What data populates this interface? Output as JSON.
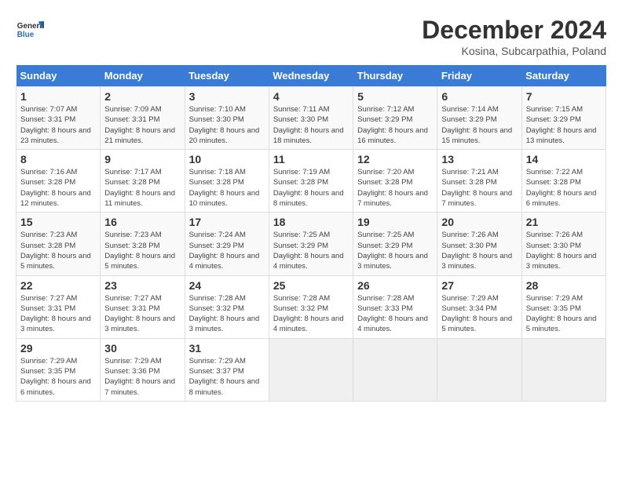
{
  "header": {
    "logo": {
      "general": "General",
      "blue": "Blue"
    },
    "title": "December 2024",
    "location": "Kosina, Subcarpathia, Poland"
  },
  "days_of_week": [
    "Sunday",
    "Monday",
    "Tuesday",
    "Wednesday",
    "Thursday",
    "Friday",
    "Saturday"
  ],
  "weeks": [
    [
      {
        "day": "1",
        "sunrise": "Sunrise: 7:07 AM",
        "sunset": "Sunset: 3:31 PM",
        "daylight": "Daylight: 8 hours and 23 minutes."
      },
      {
        "day": "2",
        "sunrise": "Sunrise: 7:09 AM",
        "sunset": "Sunset: 3:31 PM",
        "daylight": "Daylight: 8 hours and 21 minutes."
      },
      {
        "day": "3",
        "sunrise": "Sunrise: 7:10 AM",
        "sunset": "Sunset: 3:30 PM",
        "daylight": "Daylight: 8 hours and 20 minutes."
      },
      {
        "day": "4",
        "sunrise": "Sunrise: 7:11 AM",
        "sunset": "Sunset: 3:30 PM",
        "daylight": "Daylight: 8 hours and 18 minutes."
      },
      {
        "day": "5",
        "sunrise": "Sunrise: 7:12 AM",
        "sunset": "Sunset: 3:29 PM",
        "daylight": "Daylight: 8 hours and 16 minutes."
      },
      {
        "day": "6",
        "sunrise": "Sunrise: 7:14 AM",
        "sunset": "Sunset: 3:29 PM",
        "daylight": "Daylight: 8 hours and 15 minutes."
      },
      {
        "day": "7",
        "sunrise": "Sunrise: 7:15 AM",
        "sunset": "Sunset: 3:29 PM",
        "daylight": "Daylight: 8 hours and 13 minutes."
      }
    ],
    [
      {
        "day": "8",
        "sunrise": "Sunrise: 7:16 AM",
        "sunset": "Sunset: 3:28 PM",
        "daylight": "Daylight: 8 hours and 12 minutes."
      },
      {
        "day": "9",
        "sunrise": "Sunrise: 7:17 AM",
        "sunset": "Sunset: 3:28 PM",
        "daylight": "Daylight: 8 hours and 11 minutes."
      },
      {
        "day": "10",
        "sunrise": "Sunrise: 7:18 AM",
        "sunset": "Sunset: 3:28 PM",
        "daylight": "Daylight: 8 hours and 10 minutes."
      },
      {
        "day": "11",
        "sunrise": "Sunrise: 7:19 AM",
        "sunset": "Sunset: 3:28 PM",
        "daylight": "Daylight: 8 hours and 8 minutes."
      },
      {
        "day": "12",
        "sunrise": "Sunrise: 7:20 AM",
        "sunset": "Sunset: 3:28 PM",
        "daylight": "Daylight: 8 hours and 7 minutes."
      },
      {
        "day": "13",
        "sunrise": "Sunrise: 7:21 AM",
        "sunset": "Sunset: 3:28 PM",
        "daylight": "Daylight: 8 hours and 7 minutes."
      },
      {
        "day": "14",
        "sunrise": "Sunrise: 7:22 AM",
        "sunset": "Sunset: 3:28 PM",
        "daylight": "Daylight: 8 hours and 6 minutes."
      }
    ],
    [
      {
        "day": "15",
        "sunrise": "Sunrise: 7:23 AM",
        "sunset": "Sunset: 3:28 PM",
        "daylight": "Daylight: 8 hours and 5 minutes."
      },
      {
        "day": "16",
        "sunrise": "Sunrise: 7:23 AM",
        "sunset": "Sunset: 3:28 PM",
        "daylight": "Daylight: 8 hours and 5 minutes."
      },
      {
        "day": "17",
        "sunrise": "Sunrise: 7:24 AM",
        "sunset": "Sunset: 3:29 PM",
        "daylight": "Daylight: 8 hours and 4 minutes."
      },
      {
        "day": "18",
        "sunrise": "Sunrise: 7:25 AM",
        "sunset": "Sunset: 3:29 PM",
        "daylight": "Daylight: 8 hours and 4 minutes."
      },
      {
        "day": "19",
        "sunrise": "Sunrise: 7:25 AM",
        "sunset": "Sunset: 3:29 PM",
        "daylight": "Daylight: 8 hours and 3 minutes."
      },
      {
        "day": "20",
        "sunrise": "Sunrise: 7:26 AM",
        "sunset": "Sunset: 3:30 PM",
        "daylight": "Daylight: 8 hours and 3 minutes."
      },
      {
        "day": "21",
        "sunrise": "Sunrise: 7:26 AM",
        "sunset": "Sunset: 3:30 PM",
        "daylight": "Daylight: 8 hours and 3 minutes."
      }
    ],
    [
      {
        "day": "22",
        "sunrise": "Sunrise: 7:27 AM",
        "sunset": "Sunset: 3:31 PM",
        "daylight": "Daylight: 8 hours and 3 minutes."
      },
      {
        "day": "23",
        "sunrise": "Sunrise: 7:27 AM",
        "sunset": "Sunset: 3:31 PM",
        "daylight": "Daylight: 8 hours and 3 minutes."
      },
      {
        "day": "24",
        "sunrise": "Sunrise: 7:28 AM",
        "sunset": "Sunset: 3:32 PM",
        "daylight": "Daylight: 8 hours and 3 minutes."
      },
      {
        "day": "25",
        "sunrise": "Sunrise: 7:28 AM",
        "sunset": "Sunset: 3:32 PM",
        "daylight": "Daylight: 8 hours and 4 minutes."
      },
      {
        "day": "26",
        "sunrise": "Sunrise: 7:28 AM",
        "sunset": "Sunset: 3:33 PM",
        "daylight": "Daylight: 8 hours and 4 minutes."
      },
      {
        "day": "27",
        "sunrise": "Sunrise: 7:29 AM",
        "sunset": "Sunset: 3:34 PM",
        "daylight": "Daylight: 8 hours and 5 minutes."
      },
      {
        "day": "28",
        "sunrise": "Sunrise: 7:29 AM",
        "sunset": "Sunset: 3:35 PM",
        "daylight": "Daylight: 8 hours and 5 minutes."
      }
    ],
    [
      {
        "day": "29",
        "sunrise": "Sunrise: 7:29 AM",
        "sunset": "Sunset: 3:35 PM",
        "daylight": "Daylight: 8 hours and 6 minutes."
      },
      {
        "day": "30",
        "sunrise": "Sunrise: 7:29 AM",
        "sunset": "Sunset: 3:36 PM",
        "daylight": "Daylight: 8 hours and 7 minutes."
      },
      {
        "day": "31",
        "sunrise": "Sunrise: 7:29 AM",
        "sunset": "Sunset: 3:37 PM",
        "daylight": "Daylight: 8 hours and 8 minutes."
      },
      null,
      null,
      null,
      null
    ]
  ]
}
